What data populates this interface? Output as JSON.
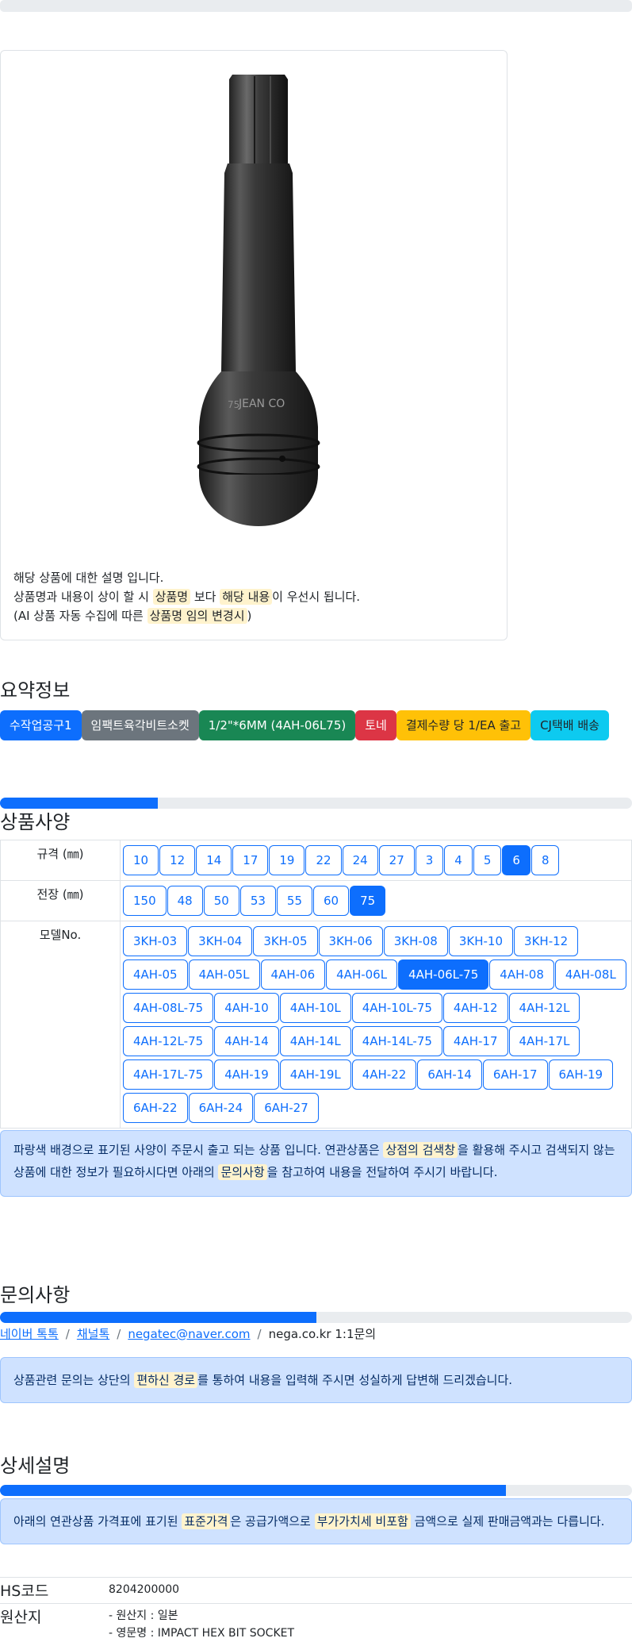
{
  "image_card": {
    "product_image_alt": "impact hex bit socket",
    "brand_mark": "JEAN CO",
    "size_mark": "75",
    "desc_line1": "해당 상품에 대한 설명 입니다.",
    "desc_line2_pre": "상품명과 내용이 상이 할 시 ",
    "desc_line2_hl1": "상품명",
    "desc_line2_mid": " 보다 ",
    "desc_line2_hl2": "해당 내용",
    "desc_line2_post": "이 우선시 됩니다.",
    "desc_line3_pre": "(AI 상품 자동 수집에 따른 ",
    "desc_line3_hl": "상품명 임의 변경시",
    "desc_line3_post": ")"
  },
  "summary": {
    "title": "요약정보",
    "badges": [
      {
        "label": "수작업공구1",
        "color": "#0d6efd",
        "text_color": "#ffffff"
      },
      {
        "label": "임팩트육각비트소켓",
        "color": "#6c757d",
        "text_color": "#ffffff"
      },
      {
        "label": "1/2\"*6MM (4AH-06L75)",
        "color": "#198754",
        "text_color": "#ffffff"
      },
      {
        "label": "토네",
        "color": "#dc3545",
        "text_color": "#ffffff"
      },
      {
        "label": "결제수량 당 1/EA 출고",
        "color": "#ffc107",
        "text_color": "#212529"
      },
      {
        "label": "CJ택배 배송",
        "color": "#0dcaf0",
        "text_color": "#212529"
      }
    ]
  },
  "spec": {
    "title": "상품사양",
    "progress_percent": 25,
    "rows": [
      {
        "label": "규격 (㎜)",
        "options": [
          "10",
          "12",
          "14",
          "17",
          "19",
          "22",
          "24",
          "27",
          "3",
          "4",
          "5",
          "6",
          "8"
        ],
        "selected": "6"
      },
      {
        "label": "전장 (㎜)",
        "options": [
          "150",
          "48",
          "50",
          "53",
          "55",
          "60",
          "75"
        ],
        "selected": "75"
      },
      {
        "label": "모델No.",
        "options": [
          "3KH-03",
          "3KH-04",
          "3KH-05",
          "3KH-06",
          "3KH-08",
          "3KH-10",
          "3KH-12",
          "4AH-05",
          "4AH-05L",
          "4AH-06",
          "4AH-06L",
          "4AH-06L-75",
          "4AH-08",
          "4AH-08L",
          "4AH-08L-75",
          "4AH-10",
          "4AH-10L",
          "4AH-10L-75",
          "4AH-12",
          "4AH-12L",
          "4AH-12L-75",
          "4AH-14",
          "4AH-14L",
          "4AH-14L-75",
          "4AH-17",
          "4AH-17L",
          "4AH-17L-75",
          "4AH-19",
          "4AH-19L",
          "4AH-22",
          "6AH-14",
          "6AH-17",
          "6AH-19",
          "6AH-22",
          "6AH-24",
          "6AH-27"
        ],
        "selected": "4AH-06L-75"
      }
    ],
    "notice_pre": "파랑색 배경으로 표기된 사양이 주문시 출고 되는 상품 입니다. 연관상품은 ",
    "notice_hl1": "상점의 검색창",
    "notice_mid": "을 활용해 주시고 검색되지 않는 상품에 대한 정보가 필요하시다면 아래의 ",
    "notice_hl2": "문의사항",
    "notice_post": "을 참고하여 내용을 전달하여 주시기 바랍니다."
  },
  "inquiry": {
    "title": "문의사항",
    "progress_percent": 50,
    "links": [
      "네이버 톡톡",
      "채널톡",
      "negatec@naver.com"
    ],
    "plain": "nega.co.kr 1:1문의",
    "separator": "/",
    "notice_pre": "상품관련 문의는 상단의 ",
    "notice_hl": "편하신 경로",
    "notice_post": "를 통하여 내용을 입력해 주시면 성실하게 답변해 드리겠습니다."
  },
  "detail": {
    "title": "상세설명",
    "progress_percent": 80,
    "notice_pre": "아래의 연관상품 가격표에 표기된 ",
    "notice_hl1": "표준가격",
    "notice_mid": "은 공급가액으로 ",
    "notice_hl2": "부가가치세 비포함",
    "notice_post": " 금액으로 실제 판매금액과는 다릅니다.",
    "hs_label": "HS코드",
    "hs_value": "8204200000",
    "origin_label": "원산지",
    "origin_line1": "- 원산지 : 일본",
    "origin_line2": "- 영문명 : IMPACT HEX BIT SOCKET"
  }
}
